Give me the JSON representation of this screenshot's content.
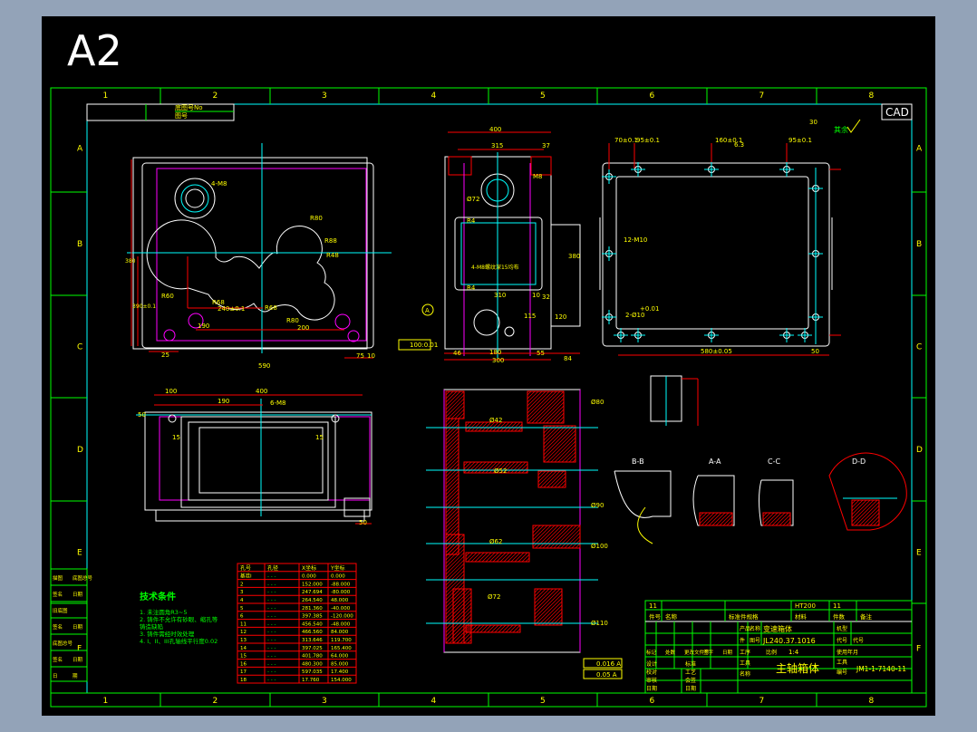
{
  "sheet": {
    "size_label": "A2",
    "cad_label": "CAD",
    "background_color": "#000000",
    "frame_color": "#00ff00",
    "inner_frame_color": "#00ffff",
    "columns": [
      "1",
      "2",
      "3",
      "4",
      "5",
      "6",
      "7",
      "8"
    ],
    "rows": [
      "A",
      "B",
      "C",
      "D",
      "E",
      "F"
    ]
  },
  "top_left_box": {
    "line1": "底图号No",
    "line2": "图号"
  },
  "roughness_note": "其余",
  "view_front": {
    "dims": [
      "4-M8",
      "R80",
      "R88",
      "R48",
      "R60",
      "R68",
      "240±0.1",
      "R68",
      "R80",
      "190",
      "200",
      "25",
      "75",
      "10",
      "590",
      "380",
      "390±0.1"
    ]
  },
  "view_side": {
    "dims": [
      "400",
      "315",
      "37",
      "Ø72",
      "M8",
      "R4",
      "4-M8螺纹深15均布",
      "R4",
      "310",
      "10",
      "32",
      "115",
      "120",
      "380",
      "46",
      "180",
      "55",
      "300",
      "84"
    ],
    "datum": "A",
    "tolerance": "0.01",
    "datum_flat": "100:0.01"
  },
  "view_right": {
    "dims": [
      "70±0.1",
      "95±0.1",
      "160±0.1",
      "95±0.1",
      "30",
      "12-M10",
      "2-Ø10",
      "+0.01",
      "580±0.05",
      "50",
      "6.3"
    ]
  },
  "view_bottom": {
    "dims": [
      "100",
      "400",
      "190",
      "6-M8",
      "50",
      "15",
      "15",
      "50"
    ]
  },
  "section_main": {
    "tolerances": [
      "0.016 A",
      "0.05 A"
    ],
    "dims": [
      "Ø42",
      "Ø52",
      "Ø62",
      "Ø72",
      "Ø80",
      "Ø90",
      "Ø100",
      "Ø110"
    ]
  },
  "sections": [
    {
      "label": "B-B"
    },
    {
      "label": "A-A"
    },
    {
      "label": "C-C"
    },
    {
      "label": "D-D"
    }
  ],
  "tech_requirements": {
    "title": "技术条件",
    "lines": [
      "1. 未注圆角R3~5",
      "2. 铸件不允许有砂眼、缩孔等",
      "   铸造缺陷",
      "3. 铸件需经时效处理",
      "4. I、II、III孔轴线平行度0.02"
    ]
  },
  "hole_table": {
    "headers": [
      "孔号",
      "孔径",
      "X坐标",
      "Y坐标"
    ],
    "rows": [
      [
        "基准I",
        "- - -",
        "0.000",
        "0.000"
      ],
      [
        "2",
        "- - -",
        "152.000",
        "-88.000"
      ],
      [
        "3",
        "- - -",
        "247.694",
        "-80.000"
      ],
      [
        "4",
        "- - -",
        "264.540",
        "48.000"
      ],
      [
        "5",
        "- - -",
        "281.360",
        "-40.000"
      ],
      [
        "6",
        "- - -",
        "397.385",
        "-120.000"
      ],
      [
        "11",
        "- - -",
        "456.540",
        "-48.000"
      ],
      [
        "12",
        "- - -",
        "466.560",
        "84.000"
      ],
      [
        "13",
        "- - -",
        "313.646",
        "119.700"
      ],
      [
        "14",
        "- - -",
        "397.025",
        "165.400"
      ],
      [
        "15",
        "- - -",
        "401.780",
        "64.000"
      ],
      [
        "16",
        "- - -",
        "480.300",
        "85.000"
      ],
      [
        "17",
        "- - -",
        "597.035",
        "17.400"
      ],
      [
        "18",
        "- - -",
        "17.760",
        "154.000"
      ]
    ]
  },
  "left_table": {
    "rows": [
      [
        "描图",
        "底图总号"
      ],
      [
        "签名",
        "日期"
      ],
      [
        "旧底图",
        ""
      ],
      [
        "签名",
        "日期"
      ],
      [
        "底图总号",
        ""
      ],
      [
        "签名",
        "日期"
      ],
      [
        "日",
        "期"
      ]
    ]
  },
  "title_block": {
    "part_row": [
      "11",
      "",
      "",
      "HT200",
      "11",
      ""
    ],
    "header_row": [
      "件号",
      "名称",
      "标准件规格",
      "材料",
      "件数",
      "备注"
    ],
    "product_label": "产品",
    "name_label": "名称",
    "product_name": "变速箱体",
    "drawing_label": "图号",
    "drawing_no": "JL240.37.1016",
    "type_label": "机型",
    "code_label": "代号",
    "change_row": [
      "标记",
      "处数",
      "更改文件号",
      "签字",
      "日期"
    ],
    "part_label": "件",
    "process_label": "工序",
    "scale_label": "比例",
    "scale": "1:4",
    "date_label": "使用年月",
    "sign_rows": [
      [
        "设计",
        "标准"
      ],
      [
        "校对",
        "工艺"
      ],
      [
        "审核",
        "会签"
      ],
      [
        "日期",
        "日期"
      ]
    ],
    "tool_label": "工具",
    "tool_name_label": "名称",
    "part_name": "主轴箱体",
    "tool_no_label": "工具",
    "tool_code_label": "编号",
    "tool_no": "JM1-1-7140-11"
  }
}
